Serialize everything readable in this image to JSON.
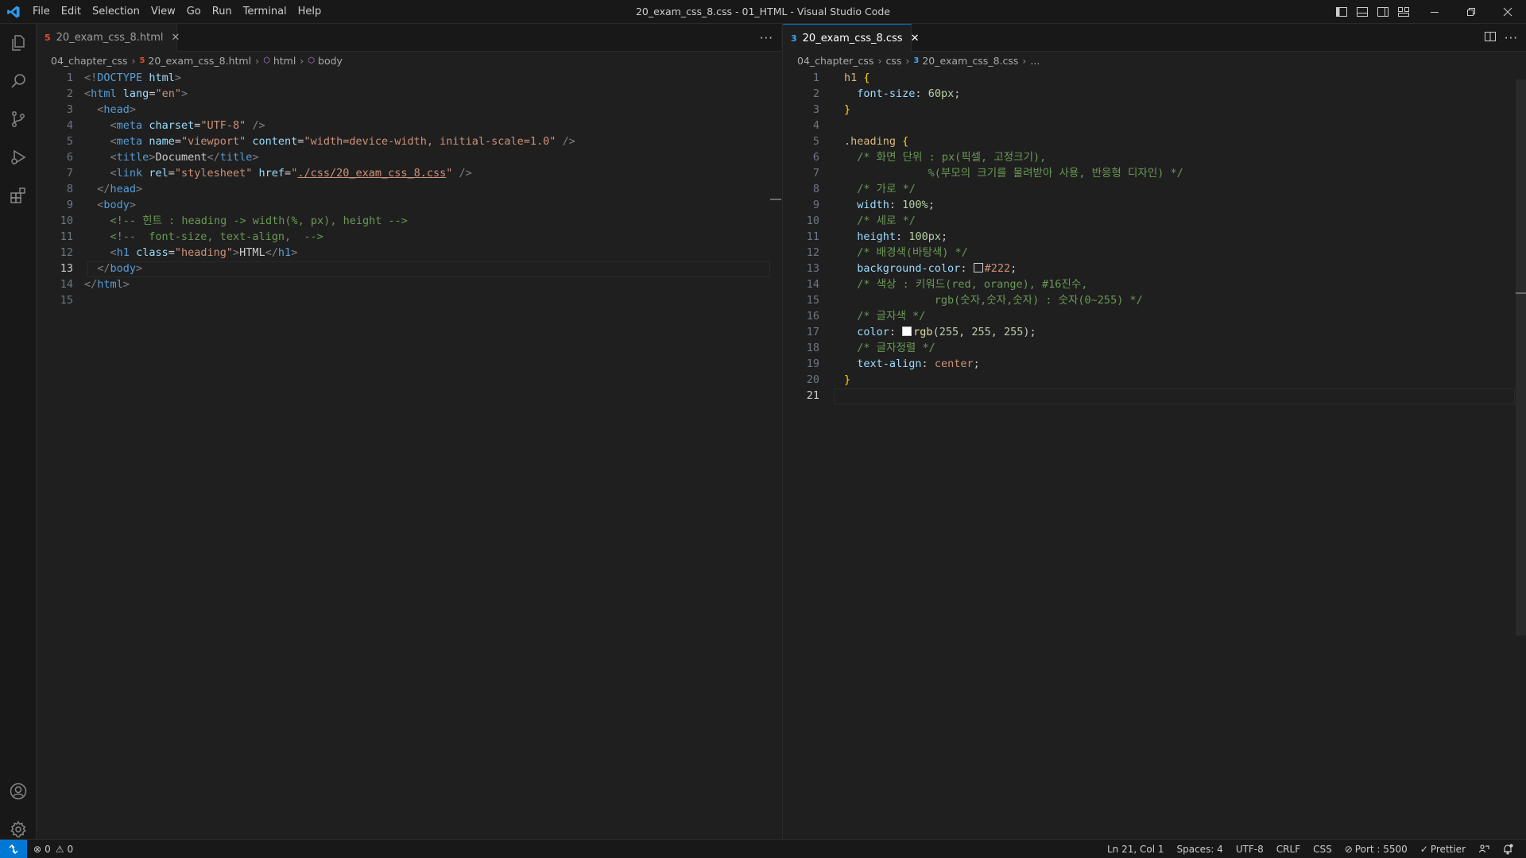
{
  "titlebar": {
    "menu": [
      "File",
      "Edit",
      "Selection",
      "View",
      "Go",
      "Run",
      "Terminal",
      "Help"
    ],
    "window_title": "20_exam_css_8.css - 01_HTML - Visual Studio Code"
  },
  "activity_bar": {
    "top": [
      "explorer-icon",
      "search-icon",
      "source-control-icon",
      "run-debug-icon",
      "extensions-icon"
    ],
    "bottom": [
      "accounts-icon",
      "manage-gear-icon"
    ]
  },
  "left_editor": {
    "tab": {
      "label": "20_exam_css_8.html",
      "file_icon": "5"
    },
    "breadcrumb": [
      "04_chapter_css",
      "20_exam_css_8.html",
      "html",
      "body"
    ],
    "current_line": 13,
    "line_numbers": [
      "1",
      "2",
      "3",
      "4",
      "5",
      "6",
      "7",
      "8",
      "9",
      "10",
      "11",
      "12",
      "13",
      "14",
      "15"
    ]
  },
  "right_editor": {
    "tab": {
      "label": "20_exam_css_8.css",
      "file_icon": "3"
    },
    "breadcrumb": [
      "04_chapter_css",
      "css",
      "20_exam_css_8.css",
      "..."
    ],
    "current_line": 21,
    "line_numbers": [
      "1",
      "2",
      "3",
      "4",
      "5",
      "6",
      "7",
      "8",
      "9",
      "10",
      "11",
      "12",
      "13",
      "14",
      "15",
      "16",
      "17",
      "18",
      "19",
      "20",
      "21"
    ]
  },
  "html_code": [
    [
      [
        "tg",
        "<!"
      ],
      [
        "tn",
        "DOCTYPE"
      ],
      [
        "tx",
        " "
      ],
      [
        "at",
        "html"
      ],
      [
        "tg",
        ">"
      ]
    ],
    [
      [
        "tg",
        "<"
      ],
      [
        "tn",
        "html"
      ],
      [
        "tx",
        " "
      ],
      [
        "at",
        "lang"
      ],
      [
        "tx",
        "="
      ],
      [
        "st",
        "\"en\""
      ],
      [
        "tg",
        ">"
      ]
    ],
    [
      [
        "tx",
        "  "
      ],
      [
        "tg",
        "<"
      ],
      [
        "tn",
        "head"
      ],
      [
        "tg",
        ">"
      ]
    ],
    [
      [
        "tx",
        "    "
      ],
      [
        "tg",
        "<"
      ],
      [
        "tn",
        "meta"
      ],
      [
        "tx",
        " "
      ],
      [
        "at",
        "charset"
      ],
      [
        "tx",
        "="
      ],
      [
        "st",
        "\"UTF-8\""
      ],
      [
        "tx",
        " "
      ],
      [
        "tg",
        "/>"
      ]
    ],
    [
      [
        "tx",
        "    "
      ],
      [
        "tg",
        "<"
      ],
      [
        "tn",
        "meta"
      ],
      [
        "tx",
        " "
      ],
      [
        "at",
        "name"
      ],
      [
        "tx",
        "="
      ],
      [
        "st",
        "\"viewport\""
      ],
      [
        "tx",
        " "
      ],
      [
        "at",
        "content"
      ],
      [
        "tx",
        "="
      ],
      [
        "st",
        "\"width=device-width, initial-scale=1.0\""
      ],
      [
        "tx",
        " "
      ],
      [
        "tg",
        "/>"
      ]
    ],
    [
      [
        "tx",
        "    "
      ],
      [
        "tg",
        "<"
      ],
      [
        "tn",
        "title"
      ],
      [
        "tg",
        ">"
      ],
      [
        "tx",
        "Document"
      ],
      [
        "tg",
        "</"
      ],
      [
        "tn",
        "title"
      ],
      [
        "tg",
        ">"
      ]
    ],
    [
      [
        "tx",
        "    "
      ],
      [
        "tg",
        "<"
      ],
      [
        "tn",
        "link"
      ],
      [
        "tx",
        " "
      ],
      [
        "at",
        "rel"
      ],
      [
        "tx",
        "="
      ],
      [
        "st",
        "\"stylesheet\""
      ],
      [
        "tx",
        " "
      ],
      [
        "at",
        "href"
      ],
      [
        "tx",
        "="
      ],
      [
        "st",
        "\""
      ],
      [
        "stu",
        "./css/20_exam_css_8.css"
      ],
      [
        "st",
        "\""
      ],
      [
        "tx",
        " "
      ],
      [
        "tg",
        "/>"
      ]
    ],
    [
      [
        "tx",
        "  "
      ],
      [
        "tg",
        "</"
      ],
      [
        "tn",
        "head"
      ],
      [
        "tg",
        ">"
      ]
    ],
    [
      [
        "tx",
        "  "
      ],
      [
        "tg",
        "<"
      ],
      [
        "tn",
        "body"
      ],
      [
        "tg",
        ">"
      ]
    ],
    [
      [
        "tx",
        "    "
      ],
      [
        "cm",
        "<!-- 힌트 : heading -> width(%, px), height -->"
      ]
    ],
    [
      [
        "tx",
        "    "
      ],
      [
        "cm",
        "<!--  font-size, text-align,  -->"
      ]
    ],
    [
      [
        "tx",
        "    "
      ],
      [
        "tg",
        "<"
      ],
      [
        "tn",
        "h1"
      ],
      [
        "tx",
        " "
      ],
      [
        "at",
        "class"
      ],
      [
        "tx",
        "="
      ],
      [
        "st",
        "\"heading\""
      ],
      [
        "tg",
        ">"
      ],
      [
        "tx",
        "HTML"
      ],
      [
        "tg",
        "</"
      ],
      [
        "tn",
        "h1"
      ],
      [
        "tg",
        ">"
      ]
    ],
    [
      [
        "tx",
        "  "
      ],
      [
        "tg",
        "</"
      ],
      [
        "tn",
        "body"
      ],
      [
        "tg",
        ">"
      ]
    ],
    [
      [
        "tg",
        "</"
      ],
      [
        "tn",
        "html"
      ],
      [
        "tg",
        ">"
      ]
    ],
    []
  ],
  "css_code": [
    [
      [
        "sel",
        "h1"
      ],
      [
        "tx",
        " "
      ],
      [
        "br",
        "{"
      ]
    ],
    [
      [
        "tx",
        "  "
      ],
      [
        "pr",
        "font-size"
      ],
      [
        "pu",
        ": "
      ],
      [
        "nm",
        "60px"
      ],
      [
        "pu",
        ";"
      ]
    ],
    [
      [
        "br",
        "}"
      ]
    ],
    [],
    [
      [
        "sel",
        ".heading"
      ],
      [
        "tx",
        " "
      ],
      [
        "br",
        "{"
      ]
    ],
    [
      [
        "tx",
        "  "
      ],
      [
        "cm",
        "/* 화면 단위 : px(픽셀, 고정크기),"
      ]
    ],
    [
      [
        "cm",
        "             %(부모의 크기를 물려받아 사용, 반응형 디자인) */"
      ]
    ],
    [
      [
        "tx",
        "  "
      ],
      [
        "cm",
        "/* 가로 */"
      ]
    ],
    [
      [
        "tx",
        "  "
      ],
      [
        "pr",
        "width"
      ],
      [
        "pu",
        ": "
      ],
      [
        "nm",
        "100%"
      ],
      [
        "pu",
        ";"
      ]
    ],
    [
      [
        "tx",
        "  "
      ],
      [
        "cm",
        "/* 세로 */"
      ]
    ],
    [
      [
        "tx",
        "  "
      ],
      [
        "pr",
        "height"
      ],
      [
        "pu",
        ": "
      ],
      [
        "nm",
        "100px"
      ],
      [
        "pu",
        ";"
      ]
    ],
    [
      [
        "tx",
        "  "
      ],
      [
        "cm",
        "/* 배경색(바탕색) */"
      ]
    ],
    [
      [
        "tx",
        "  "
      ],
      [
        "pr",
        "background-color"
      ],
      [
        "pu",
        ": "
      ],
      [
        "swatch",
        "#222222"
      ],
      [
        "kw",
        "#222"
      ],
      [
        "pu",
        ";"
      ]
    ],
    [
      [
        "tx",
        "  "
      ],
      [
        "cm",
        "/* 색상 : 키워드(red, orange), #16진수,"
      ]
    ],
    [
      [
        "cm",
        "              rgb(숫자,숫자,숫자) : 숫자(0~255) */"
      ]
    ],
    [
      [
        "tx",
        "  "
      ],
      [
        "cm",
        "/* 글자색 */"
      ]
    ],
    [
      [
        "tx",
        "  "
      ],
      [
        "pr",
        "color"
      ],
      [
        "pu",
        ": "
      ],
      [
        "swatch",
        "#ffffff"
      ],
      [
        "fn",
        "rgb"
      ],
      [
        "pu",
        "("
      ],
      [
        "nm",
        "255"
      ],
      [
        "pu",
        ", "
      ],
      [
        "nm",
        "255"
      ],
      [
        "pu",
        ", "
      ],
      [
        "nm",
        "255"
      ],
      [
        "pu",
        ");"
      ]
    ],
    [
      [
        "tx",
        "  "
      ],
      [
        "cm",
        "/* 글자정렬 */"
      ]
    ],
    [
      [
        "tx",
        "  "
      ],
      [
        "pr",
        "text-align"
      ],
      [
        "pu",
        ": "
      ],
      [
        "kw",
        "center"
      ],
      [
        "pu",
        ";"
      ]
    ],
    [
      [
        "br",
        "}"
      ]
    ],
    []
  ],
  "statusbar": {
    "errors": "0",
    "warnings": "0",
    "cursor": "Ln 21, Col 1",
    "spaces": "Spaces: 4",
    "encoding": "UTF-8",
    "eol": "CRLF",
    "language": "CSS",
    "port": "Port : 5500",
    "prettier": "Prettier"
  }
}
